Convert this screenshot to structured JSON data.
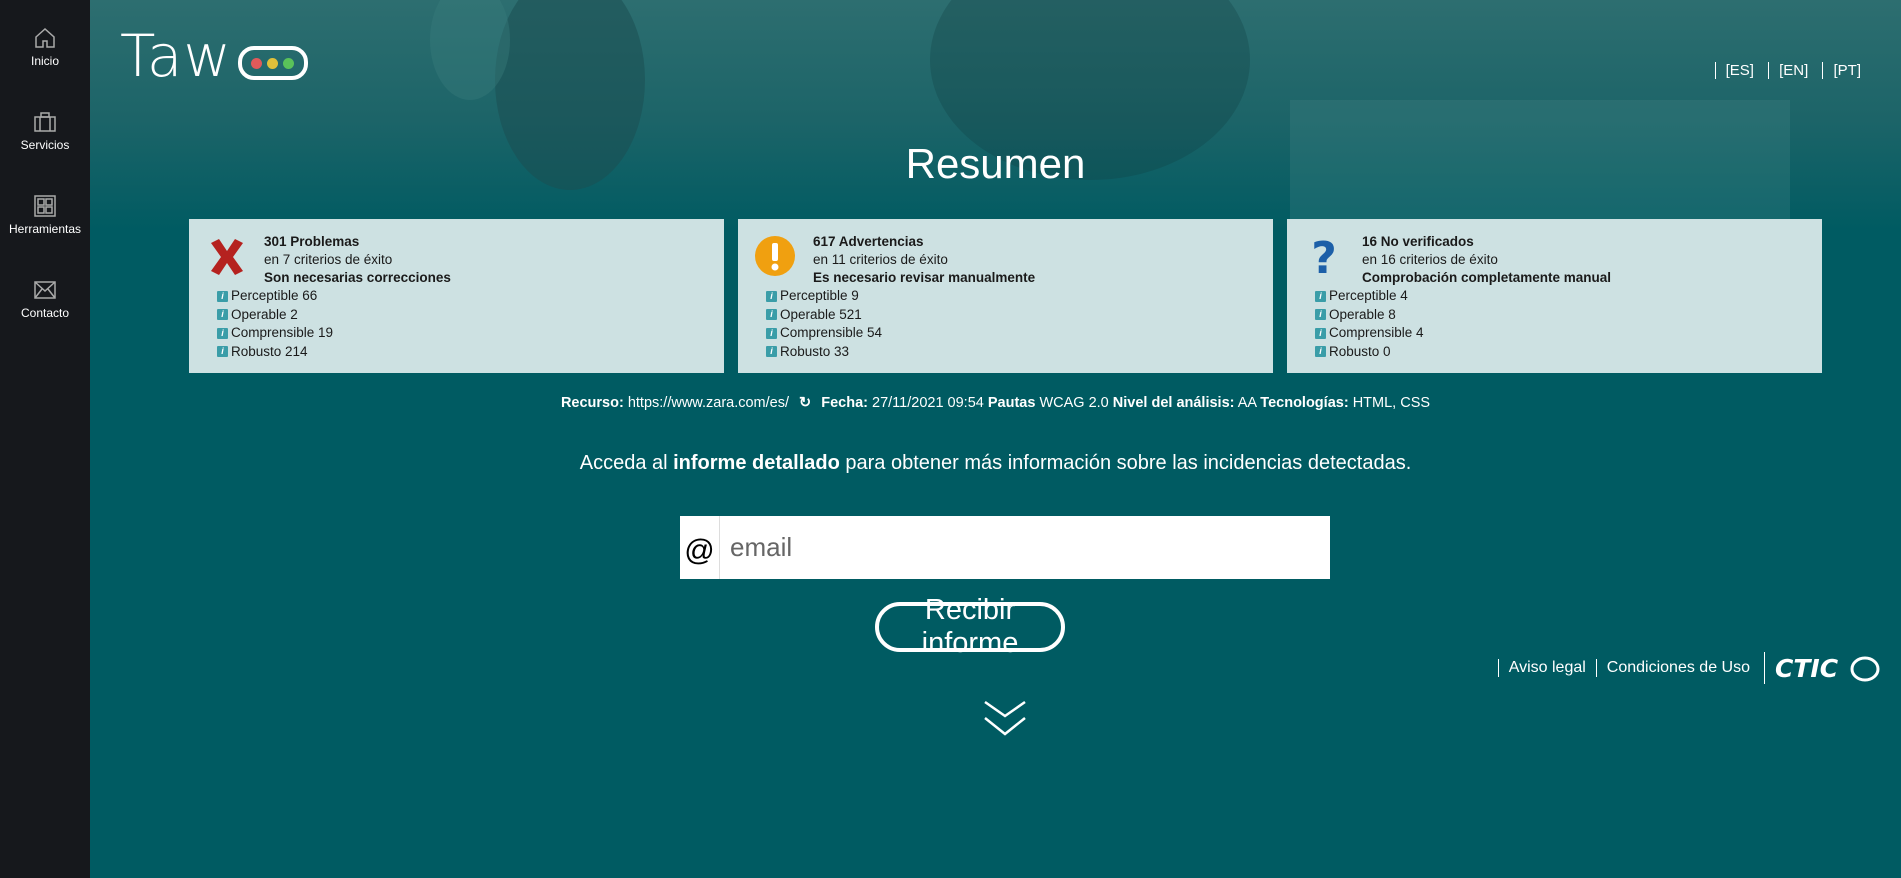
{
  "sidebar": {
    "items": [
      {
        "label": "Inicio",
        "icon": "home-icon"
      },
      {
        "label": "Servicios",
        "icon": "briefcase-icon"
      },
      {
        "label": "Herramientas",
        "icon": "grid-icon"
      },
      {
        "label": "Contacto",
        "icon": "mail-icon"
      }
    ]
  },
  "header": {
    "logo_text": "Taw",
    "logo_dots": [
      "#e05a5a",
      "#e0c03a",
      "#5ac25a"
    ],
    "languages": [
      "[ES]",
      "[EN]",
      "[PT]"
    ]
  },
  "page_title": "Resumen",
  "cards": [
    {
      "icon": "error-x-icon",
      "count_label": "301 Problemas",
      "criteria": "en 7 criterios de éxito",
      "note": "Son necesarias correcciones",
      "items": [
        "Perceptible 66",
        "Operable 2",
        "Comprensible 19",
        "Robusto 214"
      ]
    },
    {
      "icon": "warning-icon",
      "count_label": "617 Advertencias",
      "criteria": "en 11 criterios de éxito",
      "note": "Es necesario revisar manualmente",
      "items": [
        "Perceptible 9",
        "Operable 521",
        "Comprensible 54",
        "Robusto 33"
      ]
    },
    {
      "icon": "question-icon",
      "count_label": "16 No verificados",
      "criteria": "en 16 criterios de éxito",
      "note": "Comprobación completamente manual",
      "items": [
        "Perceptible 4",
        "Operable 8",
        "Comprensible 4",
        "Robusto 0"
      ]
    }
  ],
  "meta": {
    "resource_label": "Recurso:",
    "resource_value": "https://www.zara.com/es/",
    "date_label": "Fecha:",
    "date_value": "27/11/2021 09:54",
    "guidelines_label": "Pautas",
    "guidelines_value": "WCAG 2.0",
    "level_label": "Nivel del análisis:",
    "level_value": "AA",
    "tech_label": "Tecnologías:",
    "tech_value": "HTML, CSS"
  },
  "access": {
    "prefix": "Acceda al ",
    "bold": "informe detallado",
    "suffix": " para obtener más información sobre las incidencias detectadas."
  },
  "email": {
    "at_symbol": "@",
    "placeholder": "email",
    "value": ""
  },
  "submit_label": "Recibir informe",
  "footer": {
    "links": [
      "Aviso legal",
      "Condiciones de Uso"
    ],
    "brand": "CTIC"
  },
  "colors": {
    "sidebar_bg": "#16181c",
    "main_bg": "#005b62",
    "card_bg": "#cde1e2",
    "error_red": "#b5221f",
    "warning_orange": "#f0a010",
    "question_blue": "#1c5fa8"
  }
}
